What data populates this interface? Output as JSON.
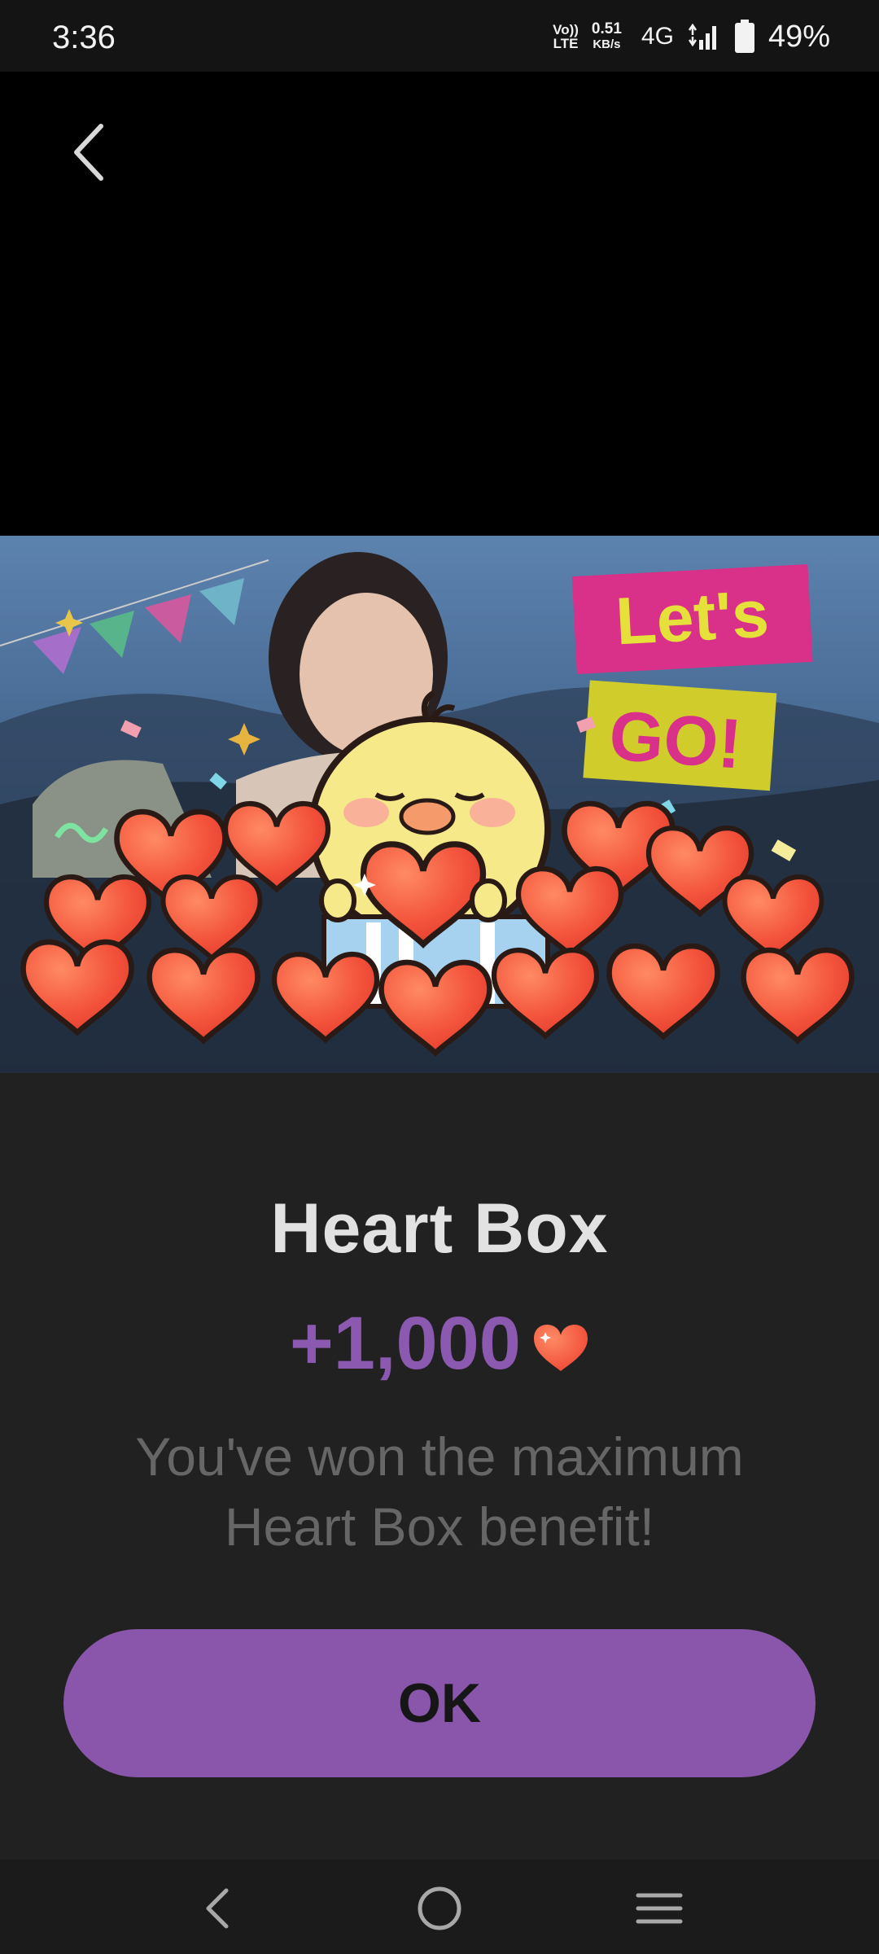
{
  "status_bar": {
    "time": "3:36",
    "volte_top": "Vo))",
    "volte_bottom": "LTE",
    "net_speed": "0.51",
    "net_speed_unit": "KB/s",
    "network": "4G",
    "battery": "49%"
  },
  "banner": {
    "sign_top": "Let's",
    "sign_bottom": "GO!"
  },
  "dialog": {
    "title": "Heart Box",
    "reward_amount": "+1,000",
    "message_line1": "You've won the maximum",
    "message_line2": "Heart Box benefit!",
    "ok_label": "OK"
  },
  "colors": {
    "accent_purple": "#8a56ab",
    "reward_text": "#8c59b0",
    "dialog_bg": "#212121",
    "heart": "#f0553e"
  },
  "icons": {
    "back": "back-arrow-icon",
    "reward": "heart-icon",
    "nav_back": "nav-back-icon",
    "nav_home": "nav-home-icon",
    "nav_recents": "nav-menu-icon"
  }
}
